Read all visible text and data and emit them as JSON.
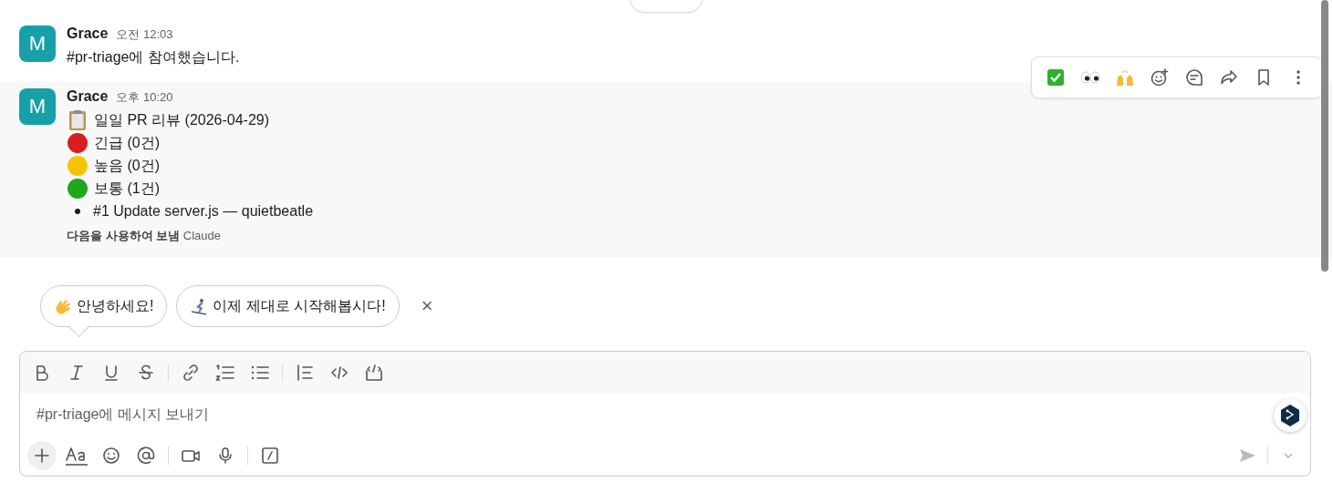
{
  "messages": [
    {
      "author": "Grace",
      "avatar": "M",
      "time": "오전 12:03",
      "highlighted": false,
      "blocks": [
        {
          "kind": "text",
          "text": "#pr-triage에 참여했습니다."
        }
      ]
    },
    {
      "author": "Grace",
      "avatar": "M",
      "time": "오후 10:20",
      "highlighted": true,
      "blocks": [
        {
          "kind": "heading",
          "text": "일일 PR 리뷰 (2026-04-29)"
        },
        {
          "kind": "priority",
          "text": "긴급 (0건)",
          "color": "#d81e1e"
        },
        {
          "kind": "priority",
          "text": "높음 (0건)",
          "color": "#f5c400"
        },
        {
          "kind": "priority",
          "text": "보통 (1건)",
          "color": "#1fa81f"
        },
        {
          "kind": "bullet",
          "text": "#1 Update server.js — quietbeatle"
        },
        {
          "kind": "footer",
          "text": "**다음을 사용하여 보냄** Claude"
        }
      ]
    }
  ],
  "suggestions": [
    {
      "kind": "wave",
      "label": "안녕하세요!"
    },
    {
      "kind": "ski",
      "label": "이제 제대로 시작해봅시다!"
    }
  ],
  "suggestions_close": "×",
  "composer": {
    "placeholder": "#pr-triage에 메시지 보내기"
  }
}
